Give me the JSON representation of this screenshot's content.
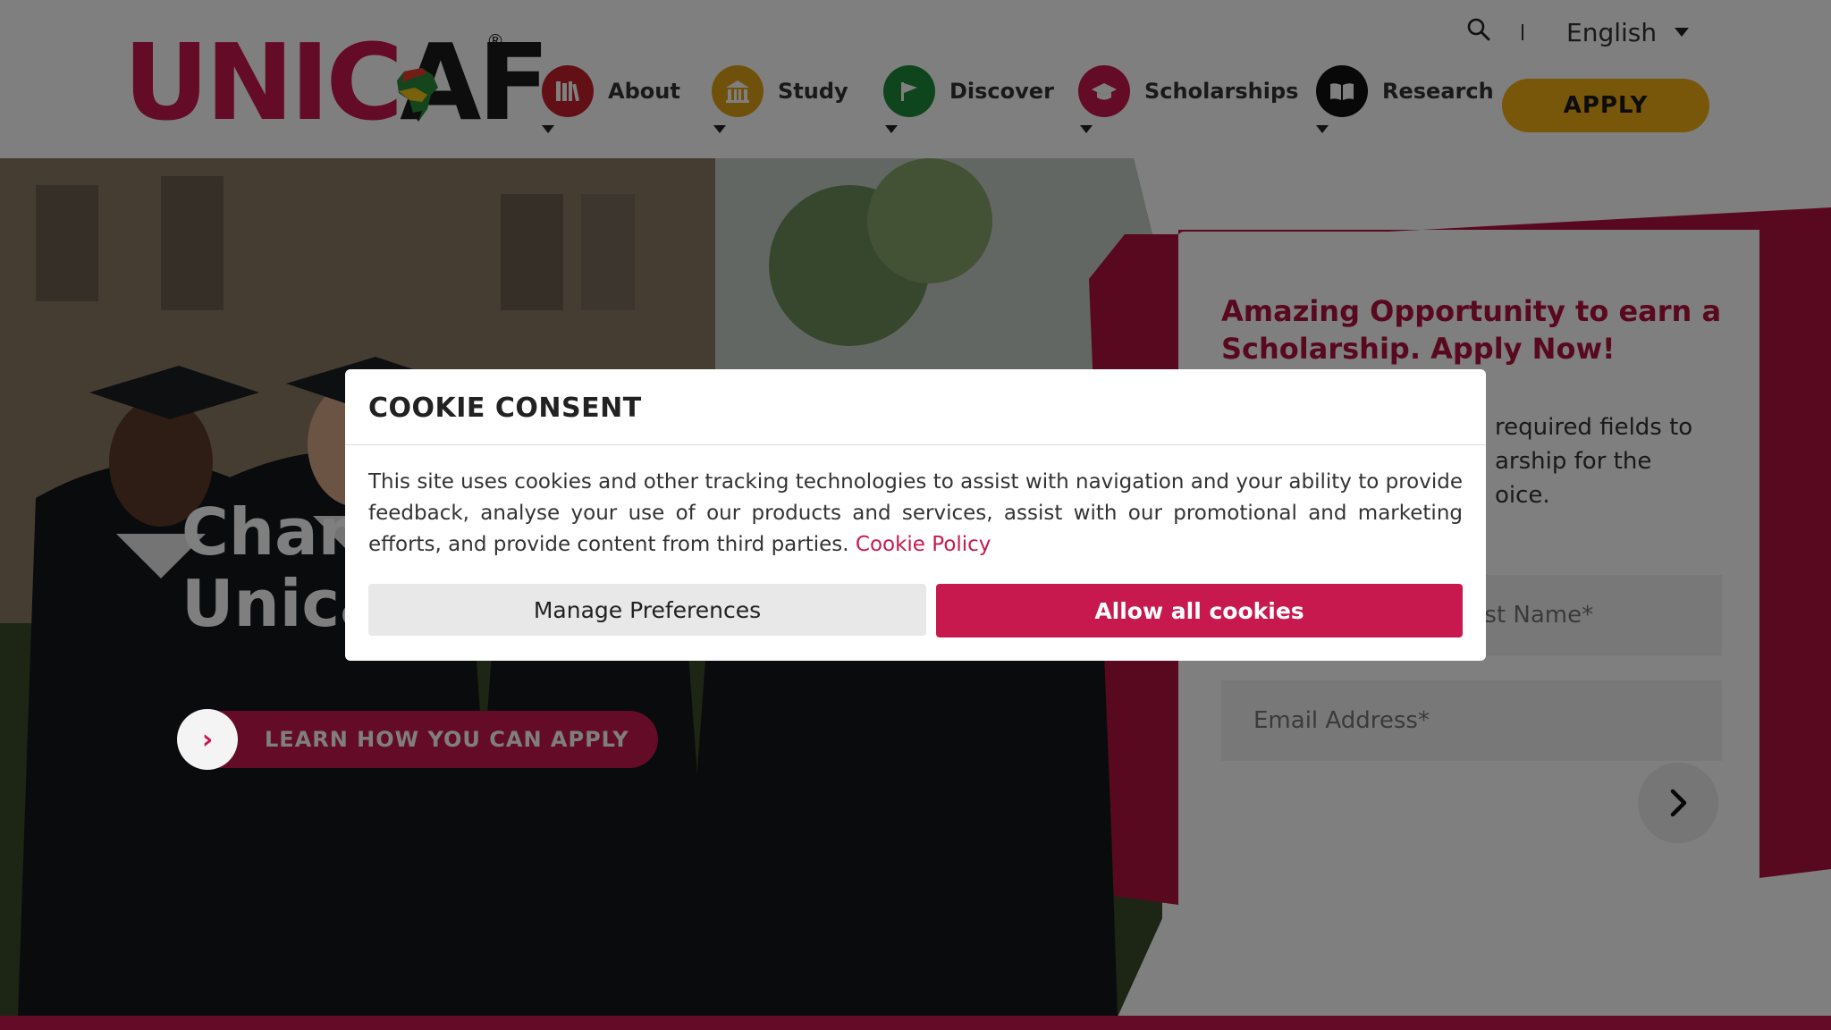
{
  "header": {
    "logo": {
      "text_part1": "UNI",
      "text_part2": "C",
      "text_part3": "AF",
      "registered": "®"
    },
    "language": "English",
    "nav": [
      {
        "label": "About",
        "icon": "books-icon",
        "color": "#c41e2a"
      },
      {
        "label": "Study",
        "icon": "building-icon",
        "color": "#e0a318"
      },
      {
        "label": "Discover",
        "icon": "flag-icon",
        "color": "#1f8a3b"
      },
      {
        "label": "Scholarships",
        "icon": "graduation-cap-icon",
        "color": "#c8194e"
      },
      {
        "label": "Research",
        "icon": "open-book-icon",
        "color": "#111111"
      }
    ],
    "apply_label": "APPLY",
    "apply_color": "#f0ac14"
  },
  "hero": {
    "title_line1": "Chan",
    "title_line2": "Unica",
    "learn_button": "LEARN HOW YOU CAN APPLY",
    "learn_chevron": "›"
  },
  "form": {
    "heading": "Amazing Opportunity to earn a Scholarship. Apply Now!",
    "desc_line1": "required fields to",
    "desc_line2": "arship for the",
    "desc_line3": "oice.",
    "last_name_placeholder": "Last Name*",
    "email_placeholder": "Email Address*",
    "next_icon": "chevron-right-icon"
  },
  "cookie_modal": {
    "title": "COOKIE CONSENT",
    "body": "This site uses cookies and other tracking technologies to assist with navigation and your ability to provide feedback, analyse your use of our products and services, assist with our promotional and marketing efforts, and provide content from third parties.",
    "policy_link": "Cookie Policy",
    "manage_label": "Manage Preferences",
    "allow_label": "Allow all cookies"
  },
  "colors": {
    "brand": "#c8194e",
    "brand_dark": "#b3123f",
    "accent_yellow": "#f0ac14"
  }
}
